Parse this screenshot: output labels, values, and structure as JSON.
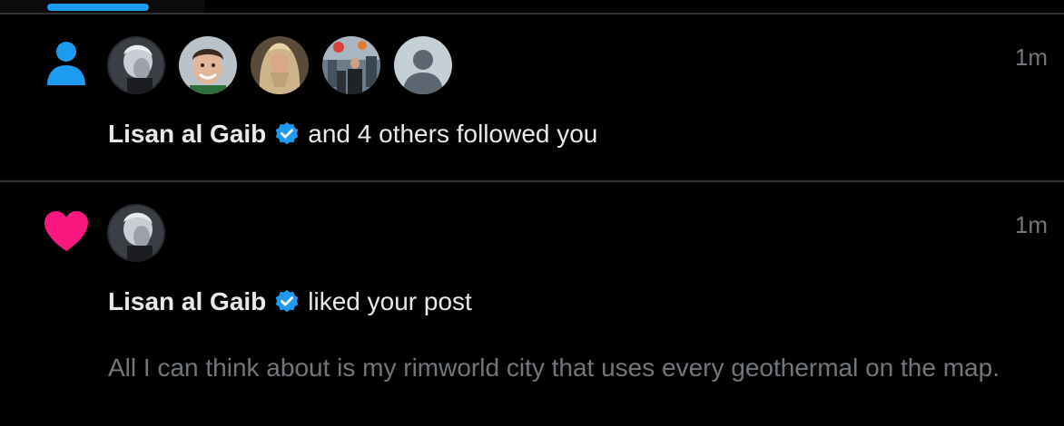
{
  "notifications": [
    {
      "type": "follow",
      "icon": "person-icon",
      "timestamp": "1m",
      "user_name": "Lisan al Gaib",
      "action_text": "and 4 others followed you",
      "avatars": [
        "avatar-lisan-al-gaib",
        "avatar-smiling-man",
        "avatar-long-hair",
        "avatar-city-crowd",
        "avatar-default"
      ]
    },
    {
      "type": "like",
      "icon": "heart-icon",
      "timestamp": "1m",
      "user_name": "Lisan al Gaib",
      "action_text": "liked your post",
      "post_text": "All I can think about is my rimworld city that uses every geothermal on the map."
    }
  ],
  "colors": {
    "background": "#000000",
    "accent": "#1d9bf0",
    "like": "#f91880",
    "muted_text": "#71767b",
    "divider": "#2f3336"
  }
}
